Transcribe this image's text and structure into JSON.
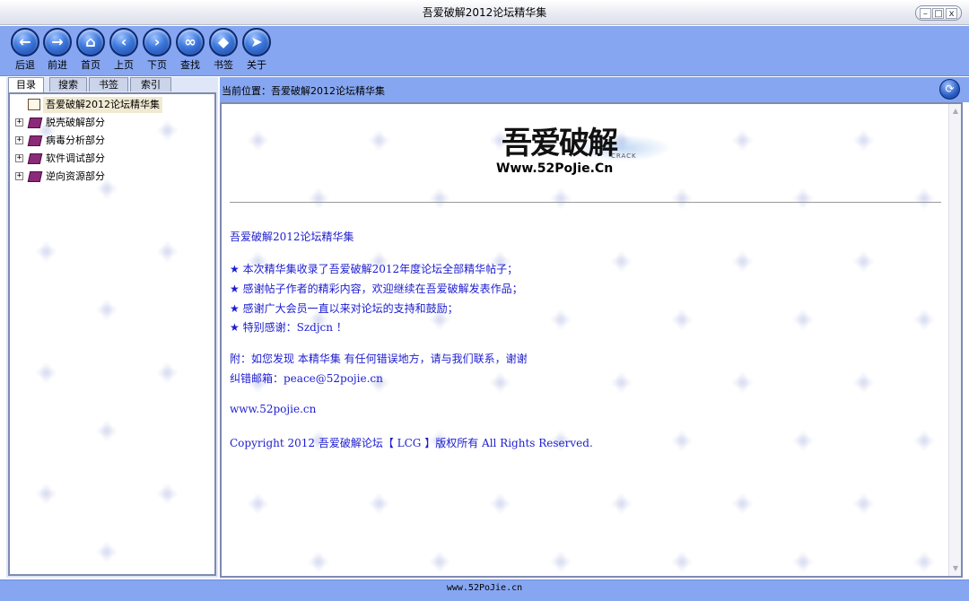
{
  "window": {
    "title": "吾爱破解2012论坛精华集",
    "controls": {
      "minimize": "–",
      "maximize": "□",
      "close": "x"
    }
  },
  "toolbar": {
    "buttons": [
      {
        "label": "后退",
        "icon": "back-arrow-icon",
        "glyph": "←"
      },
      {
        "label": "前进",
        "icon": "forward-arrow-icon",
        "glyph": "→"
      },
      {
        "label": "首页",
        "icon": "home-icon",
        "glyph": "⌂"
      },
      {
        "label": "上页",
        "icon": "previous-page-icon",
        "glyph": "‹"
      },
      {
        "label": "下页",
        "icon": "next-page-icon",
        "glyph": "›"
      },
      {
        "label": "查找",
        "icon": "binoculars-icon",
        "glyph": "∞"
      },
      {
        "label": "书签",
        "icon": "bookmark-tag-icon",
        "glyph": "◆"
      },
      {
        "label": "关于",
        "icon": "cursor-pointer-icon",
        "glyph": "➤"
      }
    ]
  },
  "sidebar": {
    "tabs": [
      "目录",
      "搜索",
      "书签",
      "索引"
    ],
    "tree": [
      {
        "label": "吾爱破解2012论坛精华集",
        "expander": "",
        "icon": "open-book-icon",
        "selected": true
      },
      {
        "label": "脱壳破解部分",
        "expander": "+",
        "icon": "book-icon",
        "selected": false
      },
      {
        "label": "病毒分析部分",
        "expander": "+",
        "icon": "book-icon",
        "selected": false
      },
      {
        "label": "软件调试部分",
        "expander": "+",
        "icon": "book-icon",
        "selected": false
      },
      {
        "label": "逆向资源部分",
        "expander": "+",
        "icon": "book-icon",
        "selected": false
      }
    ]
  },
  "address": {
    "text": "当前位置：吾爱破解2012论坛精华集",
    "button_icon": "sync-icon"
  },
  "content": {
    "logo": {
      "chinese": "吾爱破解",
      "url": "Www.52PoJie.Cn",
      "crack": "CRACK"
    },
    "heading": "吾爱破解2012论坛精华集",
    "star": "★",
    "bullets": [
      "本次精华集收录了吾爱破解2012年度论坛全部精华帖子；",
      "感谢帖子作者的精彩内容，欢迎继续在吾爱破解发表作品；",
      "感谢广大会员一直以来对论坛的支持和鼓励；",
      "特别感谢：Szdjcn ！"
    ],
    "note": "附：如您发现 本精华集 有任何错误地方，请与我们联系，谢谢",
    "email": "纠错邮箱：peace@52pojie.cn",
    "website": "www.52pojie.cn",
    "copyright": "Copyright 2012 吾爱破解论坛【 LCG 】版权所有 All Rights Reserved.",
    "scroll_up": "▲",
    "scroll_down": "▼"
  },
  "status": {
    "text": "www.52PoJie.cn"
  }
}
